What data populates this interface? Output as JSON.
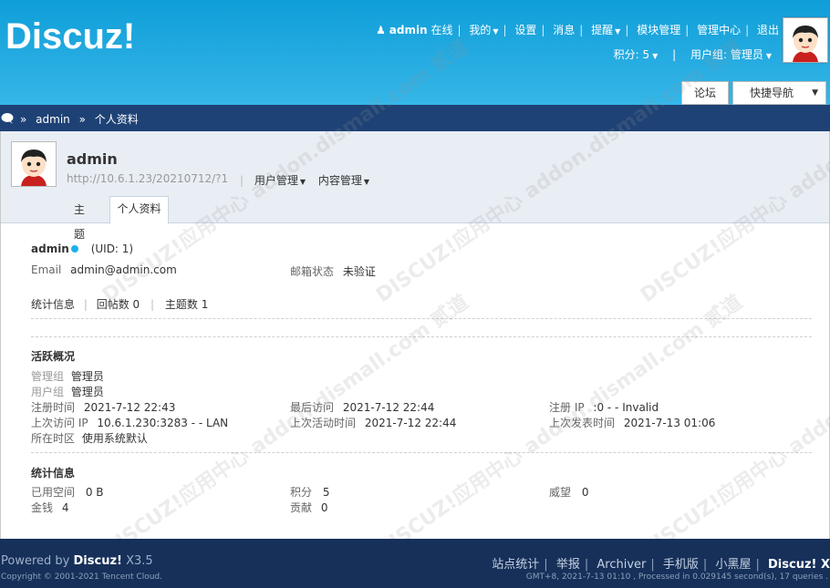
{
  "brand": {
    "logo": "Discuz!"
  },
  "topnav": {
    "username": "admin",
    "online": "在线",
    "mine": "我的",
    "settings": "设置",
    "messages": "消息",
    "reminders": "提醒",
    "module_manage": "模块管理",
    "admin_center": "管理中心",
    "logout": "退出",
    "points": "积分: 5",
    "usergroup": "用户组: 管理员"
  },
  "buttons": {
    "forum": "论坛",
    "quicknav": "快捷导航"
  },
  "breadcrumb": {
    "sep": "»",
    "items": [
      "admin",
      "个人资料"
    ]
  },
  "profile": {
    "name": "admin",
    "url": "http://10.6.1.23/20210712/?1",
    "menu": [
      "用户管理",
      "内容管理"
    ],
    "tabs": [
      "主题",
      "个人资料"
    ]
  },
  "info": {
    "name": "admin",
    "uid": "(UID: 1)",
    "email_label": "Email",
    "email": "admin@admin.com",
    "email_status_label": "邮箱状态",
    "email_status": "未验证",
    "stats_label": "统计信息",
    "reply_count": "回帖数 0",
    "thread_count": "主题数 1"
  },
  "activity": {
    "title": "活跃概况",
    "admin_group_label": "管理组",
    "admin_group": "管理员",
    "user_group_label": "用户组",
    "user_group": "管理员",
    "reg_time_label": "注册时间",
    "reg_time": "2021-7-12 22:43",
    "last_visit_label": "最后访问",
    "last_visit": "2021-7-12 22:44",
    "reg_ip_label": "注册 IP",
    "reg_ip": ":0 - - Invalid",
    "last_ip_label": "上次访问 IP",
    "last_ip": "10.6.1.230:3283 - - LAN",
    "last_active_label": "上次活动时间",
    "last_active": "2021-7-12 22:44",
    "last_post_label": "上次发表时间",
    "last_post": "2021-7-13 01:06",
    "timezone_label": "所在时区",
    "timezone": "使用系统默认"
  },
  "stats": {
    "title": "统计信息",
    "space_label": "已用空间",
    "space": "0 B",
    "points_label": "积分",
    "points": "5",
    "prestige_label": "威望",
    "prestige": "0",
    "money_label": "金钱",
    "money": "4",
    "contribution_label": "贡献",
    "contribution": "0"
  },
  "footer": {
    "powered": "Powered by",
    "brand": "Discuz!",
    "version": "X3.5",
    "copyright": "Copyright © 2001-2021 Tencent Cloud.",
    "links": [
      "站点统计",
      "举报",
      "Archiver",
      "手机版",
      "小黑屋"
    ],
    "brand_right": "Discuz! X",
    "runtime": "GMT+8, 2021-7-13 01:10 , Processed in 0.029145 second(s), 17 queries ."
  },
  "watermark": "DISCUZ!应用中心 addon.dismall.com 贰道"
}
